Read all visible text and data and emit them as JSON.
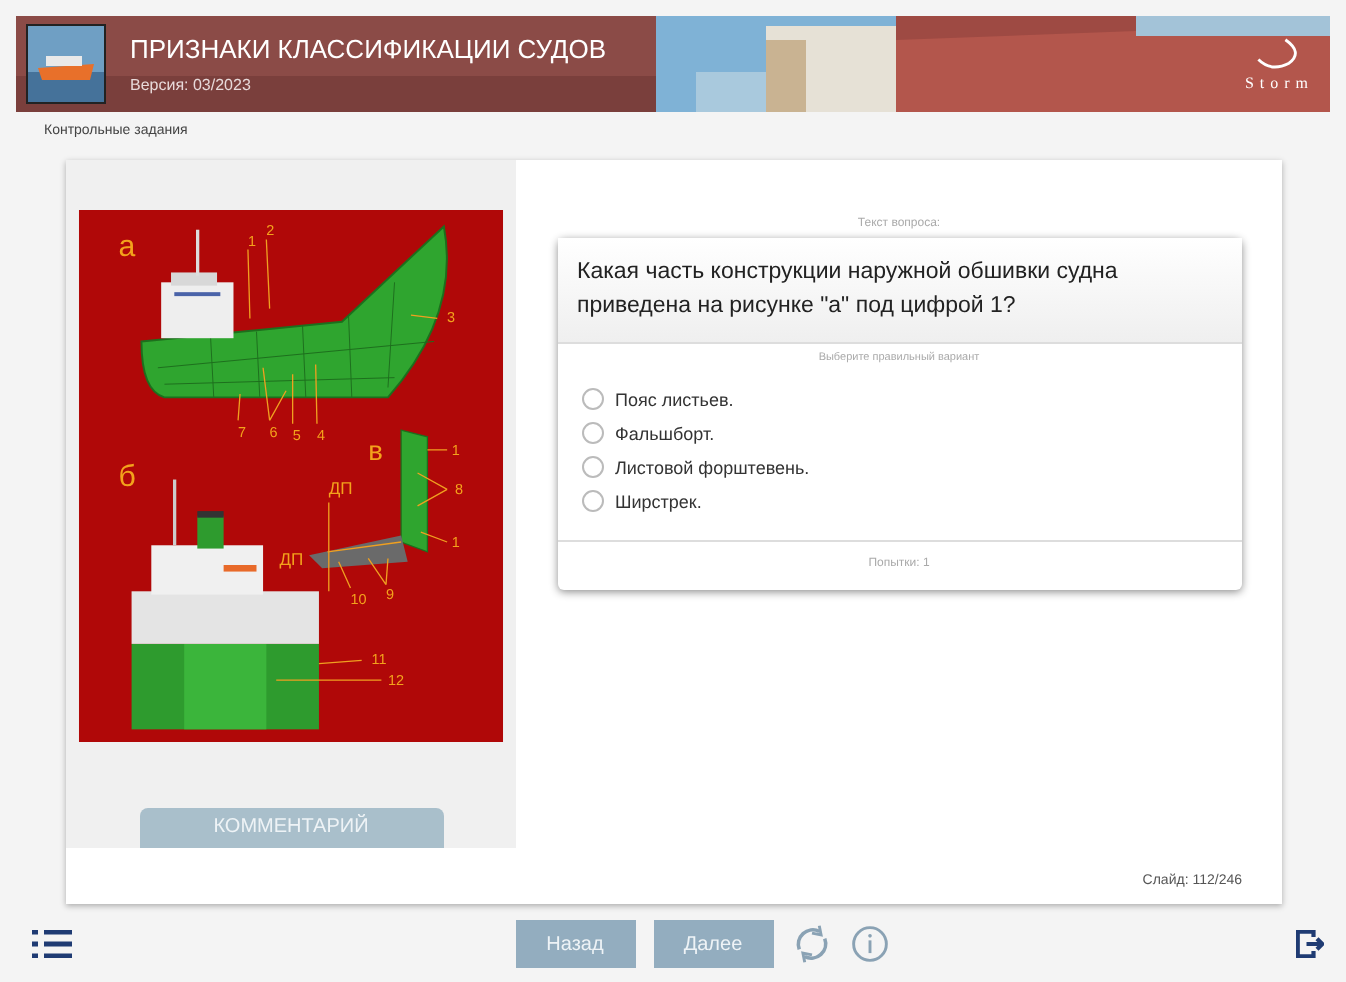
{
  "header": {
    "title": "ПРИЗНАКИ КЛАССИФИКАЦИИ СУДОВ",
    "version": "Версия: 03/2023",
    "logo": "Storm"
  },
  "breadcrumb": "Контрольные задания",
  "figure": {
    "labels": [
      {
        "text": "а"
      },
      {
        "text": "1"
      },
      {
        "text": "2"
      },
      {
        "text": "3"
      },
      {
        "text": "7"
      },
      {
        "text": "6"
      },
      {
        "text": "5"
      },
      {
        "text": "4"
      },
      {
        "text": "в"
      },
      {
        "text": "1"
      },
      {
        "text": "8"
      },
      {
        "text": "б"
      },
      {
        "text": "ДП"
      },
      {
        "text": "ДП"
      },
      {
        "text": "1"
      },
      {
        "text": "10"
      },
      {
        "text": "9"
      },
      {
        "text": "11"
      },
      {
        "text": "12"
      }
    ]
  },
  "comment_button": "КОММЕНТАРИЙ",
  "question": {
    "caption": "Текст вопроса:",
    "text": "Какая часть конструкции наружной обшивки судна приведена на рисунке \"а\" под цифрой 1?",
    "instruction": "Выберите правильный вариант",
    "options": [
      {
        "label": "Пояс листьев.",
        "selected": false
      },
      {
        "label": "Фальшборт.",
        "selected": false
      },
      {
        "label": "Листовой форштевень.",
        "selected": false
      },
      {
        "label": "Ширстрек.",
        "selected": false
      }
    ],
    "attempts": "Попытки: 1"
  },
  "slide_counter": "Слайд: 112/246",
  "nav": {
    "back": "Назад",
    "next": "Далее"
  }
}
